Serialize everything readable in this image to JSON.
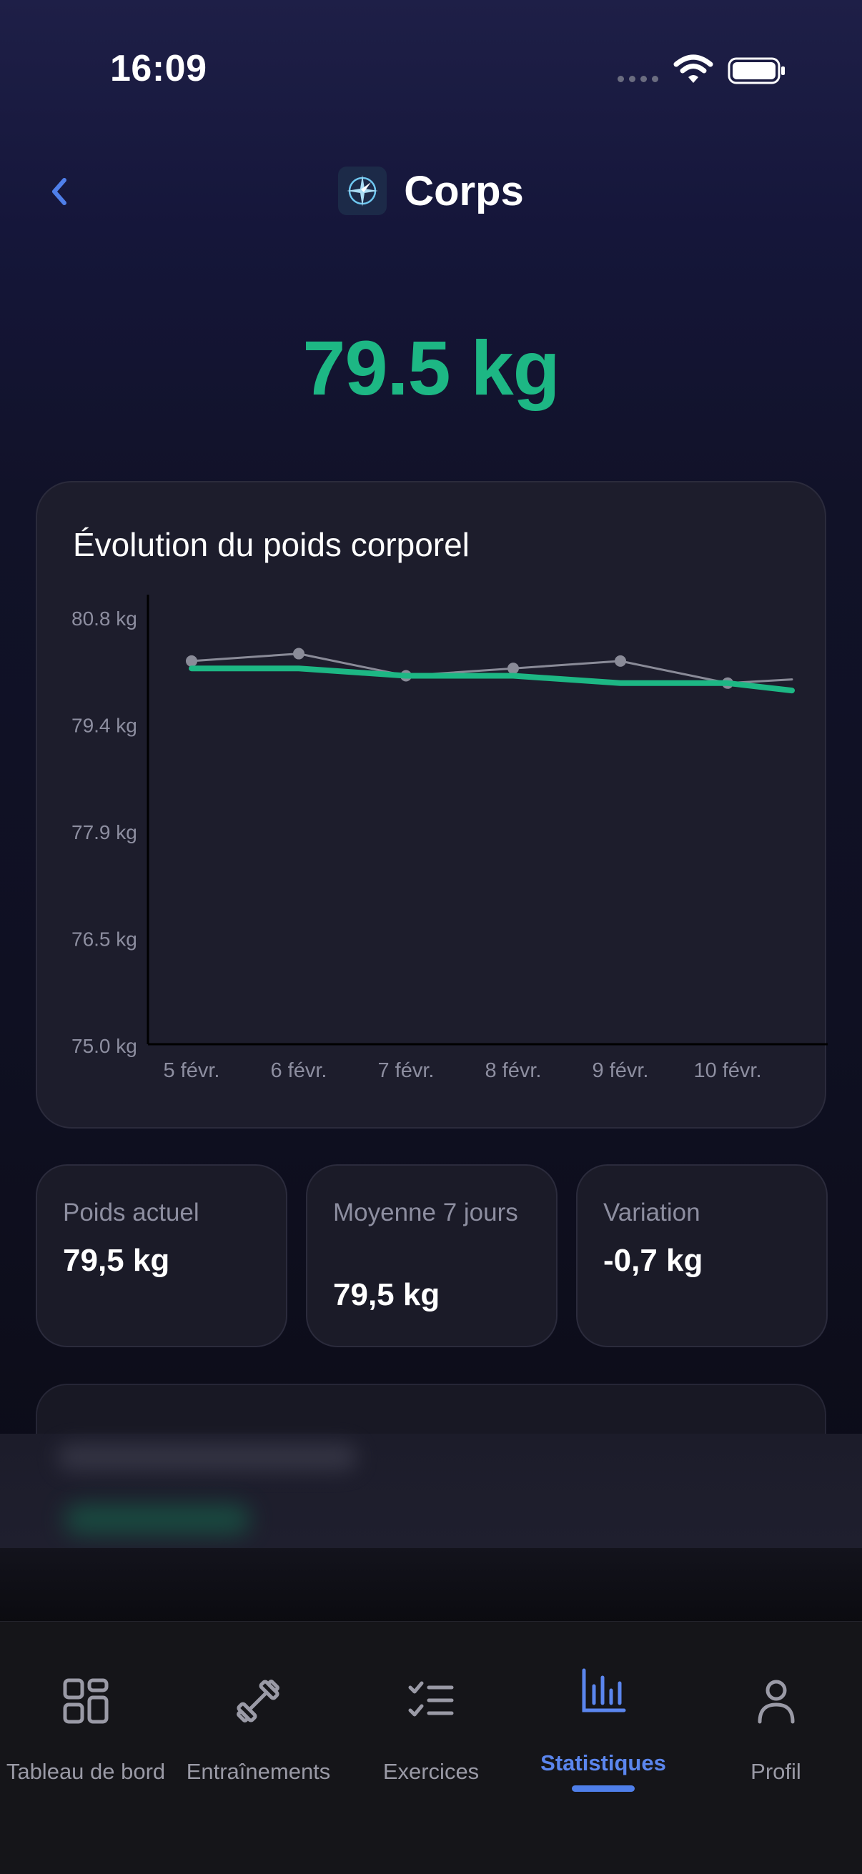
{
  "status_bar": {
    "time": "16:09"
  },
  "header": {
    "title": "Corps",
    "back_icon": "chevron-left-icon",
    "logo_icon": "compass-icon"
  },
  "current_weight_display": "79.5 kg",
  "chart_card": {
    "title": "Évolution du poids corporel"
  },
  "chart_data": {
    "type": "line",
    "title": "Évolution du poids corporel",
    "x": [
      "5 févr.",
      "6 févr.",
      "7 févr.",
      "8 févr.",
      "9 févr.",
      "10 févr."
    ],
    "y_ticks": [
      "75.0 kg",
      "76.5 kg",
      "77.9 kg",
      "79.4 kg",
      "80.8 kg"
    ],
    "ylim": [
      75.0,
      80.8
    ],
    "series": [
      {
        "values": [
          80.2,
          80.3,
          80.0,
          80.1,
          80.2,
          79.9,
          79.95
        ],
        "color": "#8a8b98",
        "x_index": [
          0,
          1,
          2,
          3,
          4,
          5,
          5.6
        ]
      },
      {
        "values": [
          80.1,
          80.1,
          80.0,
          80.0,
          79.9,
          79.9,
          79.8
        ],
        "color": "#1db784",
        "x_index": [
          0,
          1,
          2,
          3,
          4,
          5,
          5.6
        ]
      }
    ],
    "grid": false
  },
  "stats": [
    {
      "label": "Poids actuel",
      "value": "79,5 kg"
    },
    {
      "label": "Moyenne 7 jours",
      "value": "79,5 kg"
    },
    {
      "label": "Variation",
      "value": "-0,7 kg"
    }
  ],
  "tabs": [
    {
      "label": "Tableau de bord",
      "icon": "dashboard-grid-icon",
      "active": false
    },
    {
      "label": "Entraînements",
      "icon": "dumbbell-icon",
      "active": false
    },
    {
      "label": "Exercices",
      "icon": "checklist-icon",
      "active": false
    },
    {
      "label": "Statistiques",
      "icon": "bar-chart-icon",
      "active": true
    },
    {
      "label": "Profil",
      "icon": "person-icon",
      "active": false
    }
  ],
  "colors": {
    "accent_green": "#1db784",
    "accent_blue": "#5b86ee",
    "card_bg": "#1d1d2c"
  }
}
